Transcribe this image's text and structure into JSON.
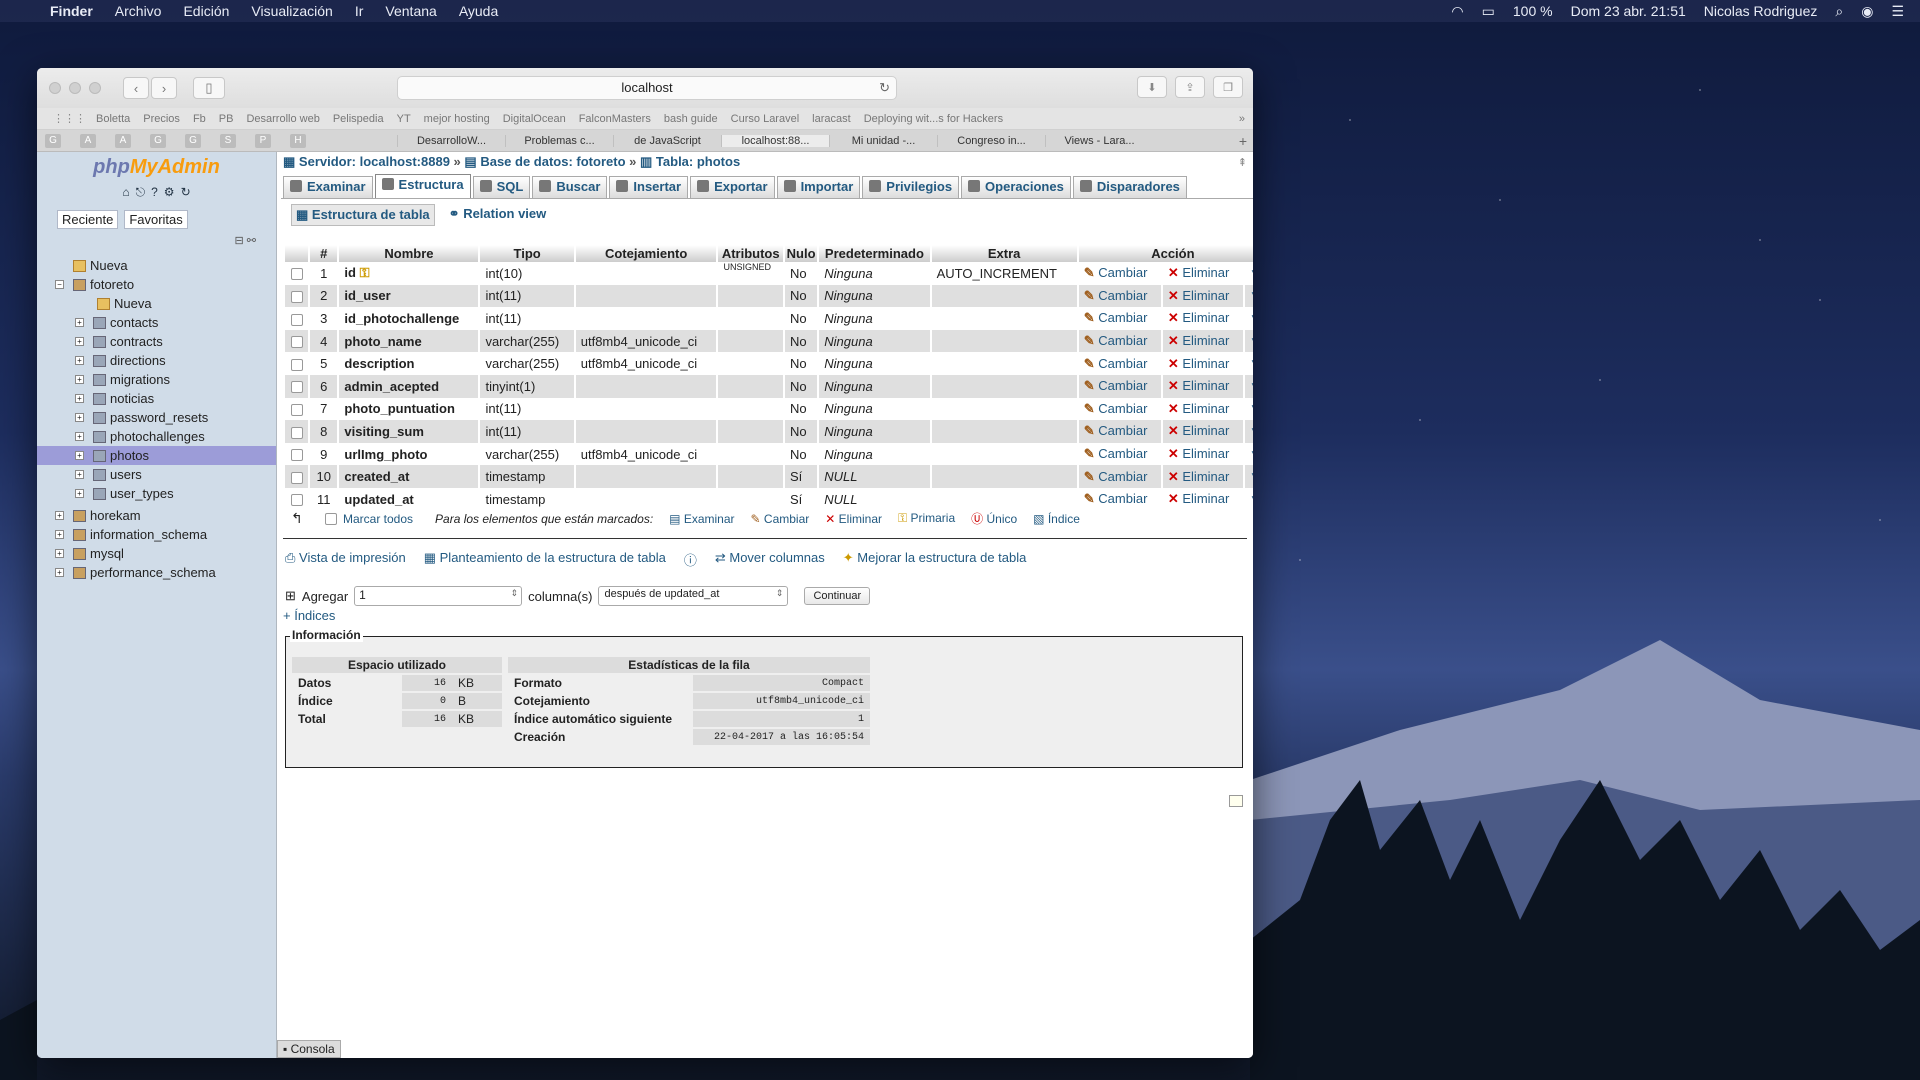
{
  "menubar": {
    "app": "Finder",
    "menus": [
      "Archivo",
      "Edición",
      "Visualización",
      "Ir",
      "Ventana",
      "Ayuda"
    ],
    "battery": "100 %",
    "clock": "Dom 23 abr.  21:51",
    "user": "Nicolas Rodriguez"
  },
  "browser": {
    "url": "localhost",
    "bookmarks": [
      "Boletta",
      "Precios",
      "Fb",
      "PB",
      "Desarrollo web",
      "Pelispedia",
      "YT",
      "mejor hosting",
      "DigitalOcean",
      "FalconMasters",
      "bash guide",
      "Curso Laravel",
      "laracast",
      "Deploying wit...s for Hackers"
    ],
    "fav_icons": [
      "G",
      "A",
      "A",
      "G",
      "G",
      "S",
      "P",
      "H"
    ],
    "tabs": [
      "DesarrolloW...",
      "Problemas c...",
      "de JavaScript",
      "localhost:88...",
      "Mi unidad -...",
      "Congreso in...",
      "Views - Lara..."
    ],
    "active_tab": 3
  },
  "sidebar": {
    "logo_a": "php",
    "logo_b": "MyAdmin",
    "tab_recent": "Reciente",
    "tab_fav": "Favoritas",
    "tree": [
      {
        "label": "Nueva",
        "level": 0,
        "type": "new"
      },
      {
        "label": "fotoreto",
        "level": 0,
        "type": "db",
        "exp": "−"
      },
      {
        "label": "Nueva",
        "level": 1,
        "type": "new"
      },
      {
        "label": "contacts",
        "level": 1,
        "type": "tbl",
        "exp": "+"
      },
      {
        "label": "contracts",
        "level": 1,
        "type": "tbl",
        "exp": "+"
      },
      {
        "label": "directions",
        "level": 1,
        "type": "tbl",
        "exp": "+"
      },
      {
        "label": "migrations",
        "level": 1,
        "type": "tbl",
        "exp": "+"
      },
      {
        "label": "noticias",
        "level": 1,
        "type": "tbl",
        "exp": "+"
      },
      {
        "label": "password_resets",
        "level": 1,
        "type": "tbl",
        "exp": "+"
      },
      {
        "label": "photochallenges",
        "level": 1,
        "type": "tbl",
        "exp": "+"
      },
      {
        "label": "photos",
        "level": 1,
        "type": "tbl",
        "exp": "+",
        "selected": true
      },
      {
        "label": "users",
        "level": 1,
        "type": "tbl",
        "exp": "+"
      },
      {
        "label": "user_types",
        "level": 1,
        "type": "tbl",
        "exp": "+"
      },
      {
        "label": "horekam",
        "level": 0,
        "type": "db",
        "exp": "+"
      },
      {
        "label": "information_schema",
        "level": 0,
        "type": "db",
        "exp": "+"
      },
      {
        "label": "mysql",
        "level": 0,
        "type": "db",
        "exp": "+"
      },
      {
        "label": "performance_schema",
        "level": 0,
        "type": "db",
        "exp": "+"
      }
    ]
  },
  "breadcrumb": {
    "server": "Servidor: localhost:8889",
    "db": "Base de datos: fotoreto",
    "table": "Tabla: photos",
    "sep": "»"
  },
  "tabs": [
    "Examinar",
    "Estructura",
    "SQL",
    "Buscar",
    "Insertar",
    "Exportar",
    "Importar",
    "Privilegios",
    "Operaciones",
    "Disparadores"
  ],
  "subtabs": [
    "Estructura de tabla",
    "Relation view"
  ],
  "columns": {
    "num": "#",
    "name": "Nombre",
    "type": "Tipo",
    "coll": "Cotejamiento",
    "attr": "Atributos",
    "null": "Nulo",
    "def": "Predeterminado",
    "extra": "Extra",
    "action": "Acción"
  },
  "actions": {
    "change": "Cambiar",
    "drop": "Eliminar"
  },
  "rows": [
    {
      "n": "1",
      "name": "id",
      "type": "int(10)",
      "coll": "",
      "attr": "UNSIGNED",
      "null": "No",
      "def": "Ninguna",
      "extra": "AUTO_INCREMENT",
      "key": true
    },
    {
      "n": "2",
      "name": "id_user",
      "type": "int(11)",
      "coll": "",
      "attr": "",
      "null": "No",
      "def": "Ninguna",
      "extra": ""
    },
    {
      "n": "3",
      "name": "id_photochallenge",
      "type": "int(11)",
      "coll": "",
      "attr": "",
      "null": "No",
      "def": "Ninguna",
      "extra": ""
    },
    {
      "n": "4",
      "name": "photo_name",
      "type": "varchar(255)",
      "coll": "utf8mb4_unicode_ci",
      "attr": "",
      "null": "No",
      "def": "Ninguna",
      "extra": ""
    },
    {
      "n": "5",
      "name": "description",
      "type": "varchar(255)",
      "coll": "utf8mb4_unicode_ci",
      "attr": "",
      "null": "No",
      "def": "Ninguna",
      "extra": ""
    },
    {
      "n": "6",
      "name": "admin_acepted",
      "type": "tinyint(1)",
      "coll": "",
      "attr": "",
      "null": "No",
      "def": "Ninguna",
      "extra": ""
    },
    {
      "n": "7",
      "name": "photo_puntuation",
      "type": "int(11)",
      "coll": "",
      "attr": "",
      "null": "No",
      "def": "Ninguna",
      "extra": ""
    },
    {
      "n": "8",
      "name": "visiting_sum",
      "type": "int(11)",
      "coll": "",
      "attr": "",
      "null": "No",
      "def": "Ninguna",
      "extra": ""
    },
    {
      "n": "9",
      "name": "urlImg_photo",
      "type": "varchar(255)",
      "coll": "utf8mb4_unicode_ci",
      "attr": "",
      "null": "No",
      "def": "Ninguna",
      "extra": ""
    },
    {
      "n": "10",
      "name": "created_at",
      "type": "timestamp",
      "coll": "",
      "attr": "",
      "null": "Sí",
      "def": "NULL",
      "extra": ""
    },
    {
      "n": "11",
      "name": "updated_at",
      "type": "timestamp",
      "coll": "",
      "attr": "",
      "null": "Sí",
      "def": "NULL",
      "extra": ""
    }
  ],
  "bulk": {
    "check_all": "Marcar todos",
    "for_marked": "Para los elementos que están marcados:",
    "items": [
      "Examinar",
      "Cambiar",
      "Eliminar",
      "Primaria",
      "Único",
      "Índice"
    ]
  },
  "links": [
    "Vista de impresión",
    "Planteamiento de la estructura de tabla",
    "Mover columnas",
    "Mejorar la estructura de tabla"
  ],
  "add": {
    "label": "Agregar",
    "value": "1",
    "columns": "columna(s)",
    "position": "después de updated_at",
    "go": "Continuar"
  },
  "indices": "+ Índices",
  "info": {
    "legend": "Información",
    "space_title": "Espacio utilizado",
    "stats_title": "Estadísticas de la fila",
    "space": [
      {
        "k": "Datos",
        "v": "16",
        "u": "KB"
      },
      {
        "k": "Índice",
        "v": "0",
        "u": "B"
      },
      {
        "k": "Total",
        "v": "16",
        "u": "KB"
      }
    ],
    "stats": [
      {
        "k": "Formato",
        "v": "Compact"
      },
      {
        "k": "Cotejamiento",
        "v": "utf8mb4_unicode_ci"
      },
      {
        "k": "Índice automático siguiente",
        "v": "1"
      },
      {
        "k": "Creación",
        "v": "22-04-2017 a las 16:05:54"
      }
    ]
  },
  "console": "Consola",
  "colors": {
    "link": "#235a81",
    "selected": "#9c9cd8",
    "sidebar": "#d0dce8"
  }
}
